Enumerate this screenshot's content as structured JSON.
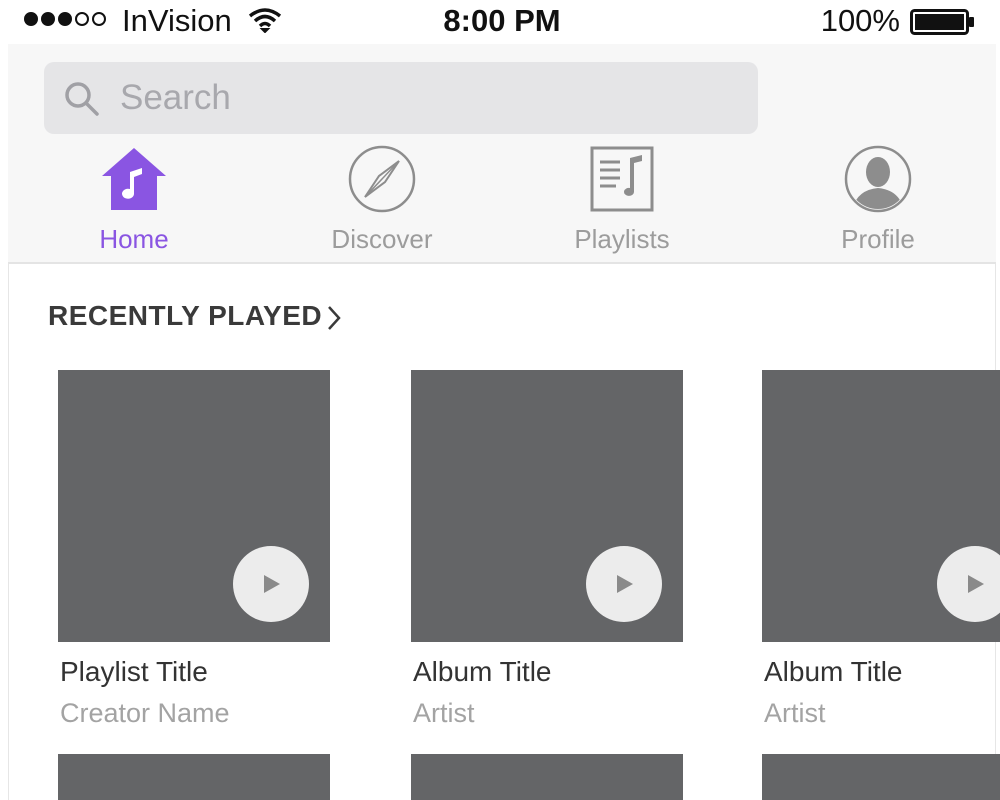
{
  "status_bar": {
    "carrier": "InVision",
    "time": "8:00 PM",
    "battery": "100%"
  },
  "search": {
    "placeholder": "Search",
    "value": ""
  },
  "tabs": [
    {
      "label": "Home",
      "icon": "home-music-icon",
      "active": true
    },
    {
      "label": "Discover",
      "icon": "compass-icon",
      "active": false
    },
    {
      "label": "Playlists",
      "icon": "playlist-icon",
      "active": false
    },
    {
      "label": "Profile",
      "icon": "profile-icon",
      "active": false
    }
  ],
  "recently_played": {
    "title": "RECENTLY PLAYED",
    "items": [
      {
        "title": "Playlist Title",
        "subtitle": "Creator Name"
      },
      {
        "title": "Album Title",
        "subtitle": "Artist"
      },
      {
        "title": "Album Title",
        "subtitle": "Artist"
      }
    ]
  },
  "colors": {
    "accent": "#8a55e2",
    "artwork_placeholder": "#646567",
    "inactive_tab": "#9c9c9c"
  }
}
